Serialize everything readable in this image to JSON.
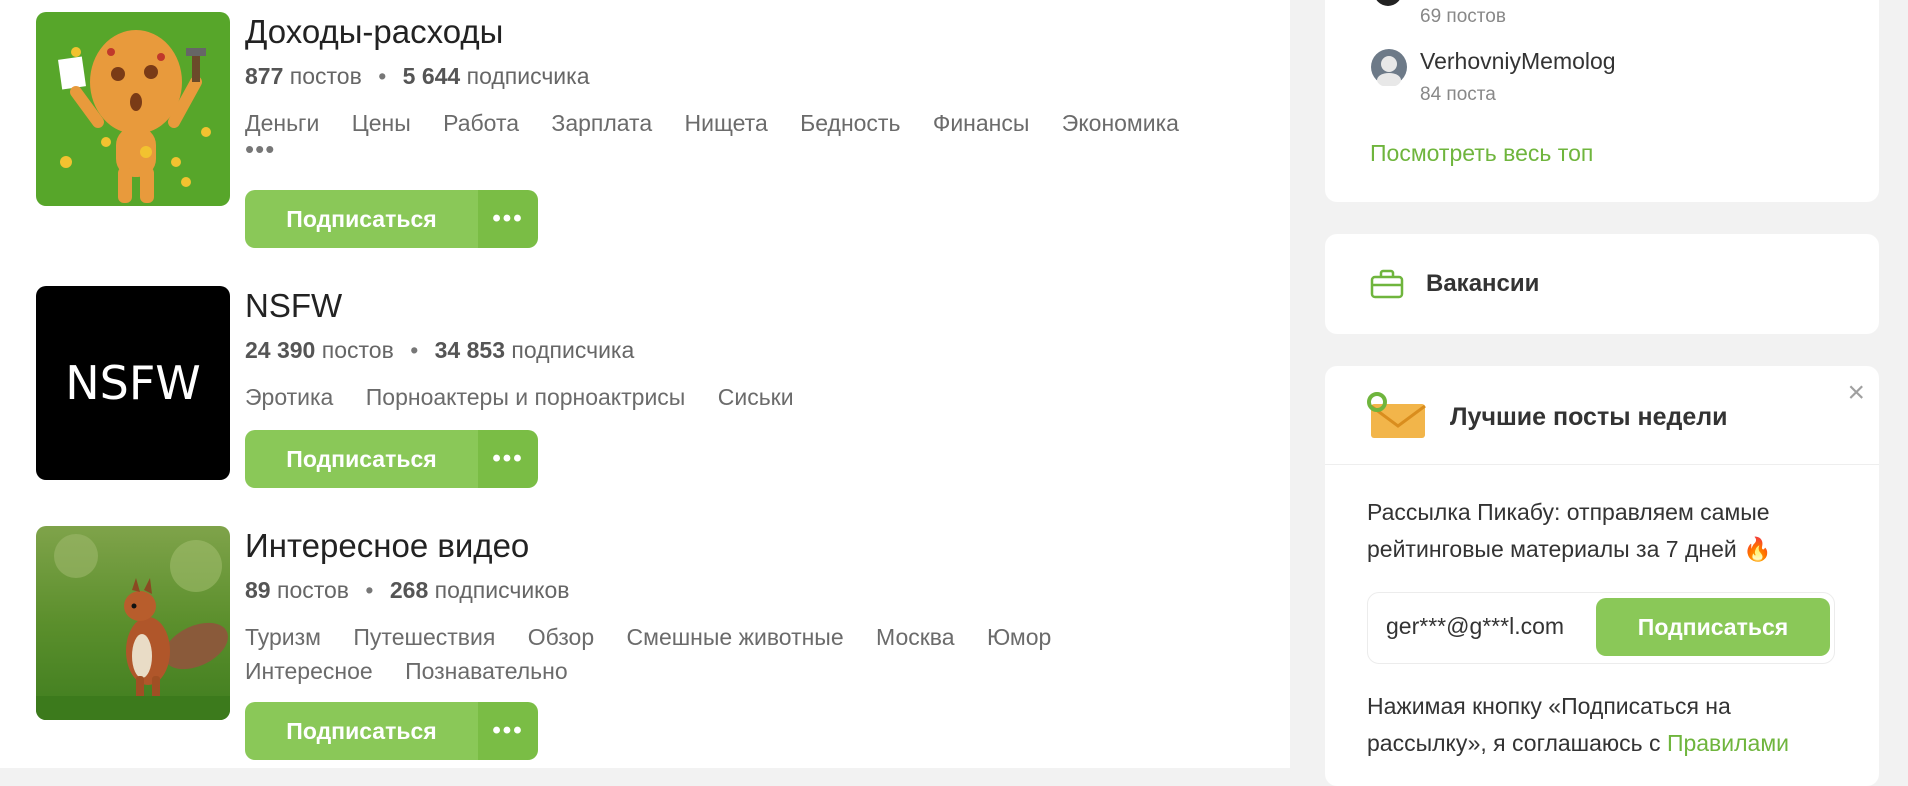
{
  "communities": [
    {
      "title": "Доходы-расходы",
      "posts_count": "877",
      "posts_label": "постов",
      "subs_count": "5 644",
      "subs_label": "подписчика",
      "tags": [
        "Деньги",
        "Цены",
        "Работа",
        "Зарплата",
        "Нищета",
        "Бедность",
        "Финансы",
        "Экономика"
      ],
      "more_tags": "•••",
      "subscribe_label": "Подписаться",
      "more_label": "•••"
    },
    {
      "title": "NSFW",
      "avatar_text": "NSFW",
      "posts_count": "24 390",
      "posts_label": "постов",
      "subs_count": "34 853",
      "subs_label": "подписчика",
      "tags": [
        "Эротика",
        "Порноактеры и порноактрисы",
        "Сиськи"
      ],
      "subscribe_label": "Подписаться",
      "more_label": "•••"
    },
    {
      "title": "Интересное видео",
      "posts_count": "89",
      "posts_label": "постов",
      "subs_count": "268",
      "subs_label": "подписчиков",
      "tags": [
        "Туризм",
        "Путешествия",
        "Обзор",
        "Смешные животные",
        "Москва",
        "Юмор",
        "Интересное",
        "Познавательно"
      ],
      "subscribe_label": "Подписаться",
      "more_label": "•••"
    }
  ],
  "stat_separator": "•",
  "sidebar": {
    "top_authors": [
      {
        "count": "69 постов"
      },
      {
        "name": "VerhovniyMemolog",
        "count": "84 поста"
      }
    ],
    "see_all_top": "Посмотреть весь топ",
    "vacancies_label": "Вакансии",
    "newsletter": {
      "title": "Лучшие посты недели",
      "close_icon": "×",
      "text_line1": "Рассылка Пикабу: отправляем самые",
      "text_line2": "рейтинговые материалы за 7 дней",
      "fire_icon": "🔥",
      "email_value": "ger***@g***l.com",
      "subscribe_label": "Подписаться",
      "agree_line1": "Нажимая кнопку «Подписаться на",
      "agree_line2_prefix": "рассылку», я соглашаюсь с",
      "agree_link": "Правилами"
    }
  },
  "colors": {
    "accent_green": "#8ac858",
    "link_green": "#6fb53d"
  }
}
